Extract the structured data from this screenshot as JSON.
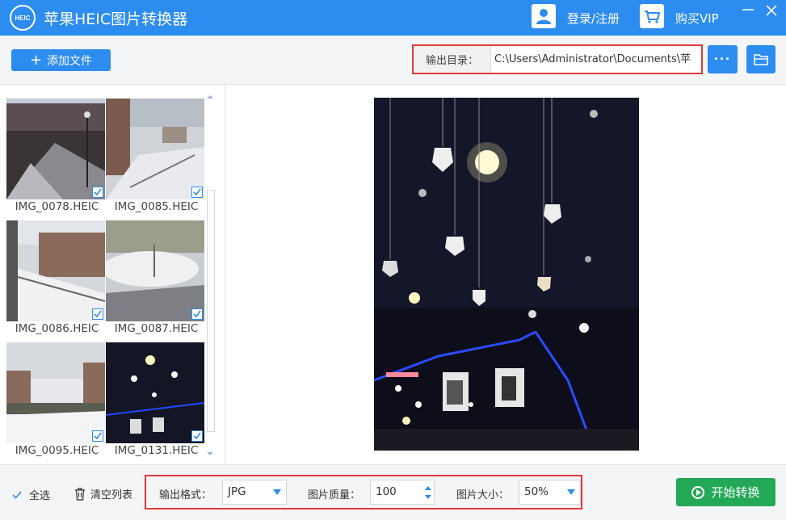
{
  "titlebar": {
    "logo_text": "HEIC",
    "app_title": "苹果HEIC图片转换器",
    "login_label": "登录/注册",
    "vip_label": "购买VIP",
    "minimize_glyph": "—",
    "close_glyph": "✕"
  },
  "toolbar": {
    "add_files_label": "添加文件",
    "output_dir_label": "输出目录：",
    "output_dir_value": "C:\\Users\\Administrator\\Documents\\苹",
    "more_label": "···"
  },
  "files": [
    {
      "name": "IMG_0078.HEIC",
      "checked": true
    },
    {
      "name": "IMG_0085.HEIC",
      "checked": true
    },
    {
      "name": "IMG_0086.HEIC",
      "checked": true
    },
    {
      "name": "IMG_0087.HEIC",
      "checked": true
    },
    {
      "name": "IMG_0095.HEIC",
      "checked": true
    },
    {
      "name": "IMG_0131.HEIC",
      "checked": true
    }
  ],
  "bottom": {
    "select_all_label": "全选",
    "clear_list_label": "清空列表",
    "format_label": "输出格式：",
    "format_value": "JPG",
    "quality_label": "图片质量：",
    "quality_value": "100",
    "size_label": "图片大小：",
    "size_value": "50%",
    "start_label": "开始转换"
  },
  "colors": {
    "accent": "#2d8cf0",
    "highlight_border": "#e03b3b",
    "start_green": "#23a858"
  }
}
